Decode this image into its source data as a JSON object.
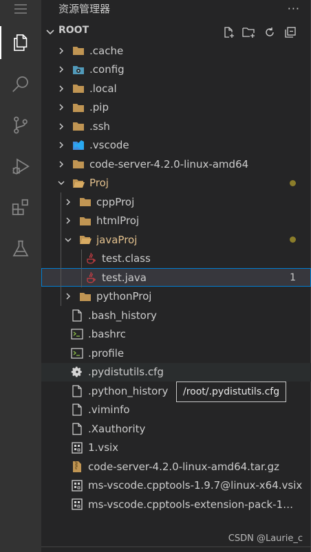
{
  "explorer": {
    "title": "资源管理器",
    "more": "···",
    "section_title": "ROOT"
  },
  "tree": [
    {
      "label": ".cache",
      "kind": "folder"
    },
    {
      "label": ".config",
      "kind": "folder-config"
    },
    {
      "label": ".local",
      "kind": "folder"
    },
    {
      "label": ".pip",
      "kind": "folder"
    },
    {
      "label": ".ssh",
      "kind": "folder"
    },
    {
      "label": ".vscode",
      "kind": "folder-vscode"
    },
    {
      "label": "code-server-4.2.0-linux-amd64",
      "kind": "folder"
    },
    {
      "label": "Proj",
      "kind": "folder-open",
      "modified": true
    },
    {
      "label": "cppProj",
      "kind": "folder"
    },
    {
      "label": "htmlProj",
      "kind": "folder"
    },
    {
      "label": "javaProj",
      "kind": "folder-open",
      "modified": true
    },
    {
      "label": "test.class",
      "kind": "java"
    },
    {
      "label": "test.java",
      "kind": "java",
      "badge": "1"
    },
    {
      "label": "pythonProj",
      "kind": "folder"
    },
    {
      "label": ".bash_history",
      "kind": "file"
    },
    {
      "label": ".bashrc",
      "kind": "shell"
    },
    {
      "label": ".profile",
      "kind": "shell"
    },
    {
      "label": ".pydistutils.cfg",
      "kind": "gear"
    },
    {
      "label": ".python_history",
      "kind": "file"
    },
    {
      "label": ".viminfo",
      "kind": "file"
    },
    {
      "label": ".Xauthority",
      "kind": "file"
    },
    {
      "label": "1.vsix",
      "kind": "vsix"
    },
    {
      "label": "code-server-4.2.0-linux-amd64.tar.gz",
      "kind": "archive"
    },
    {
      "label": "ms-vscode.cpptools-1.9.7@linux-x64.vsix",
      "kind": "vsix"
    },
    {
      "label": "ms-vscode.cpptools-extension-pack-1.1....",
      "kind": "vsix"
    }
  ],
  "tooltip": "/root/.pydistutils.cfg",
  "watermark": "CSDN @Laurie_c",
  "colors": {
    "folder": "#c09553",
    "java": "#cc3e44",
    "modified": "#e2c08d",
    "selection_border": "#007fd4"
  }
}
